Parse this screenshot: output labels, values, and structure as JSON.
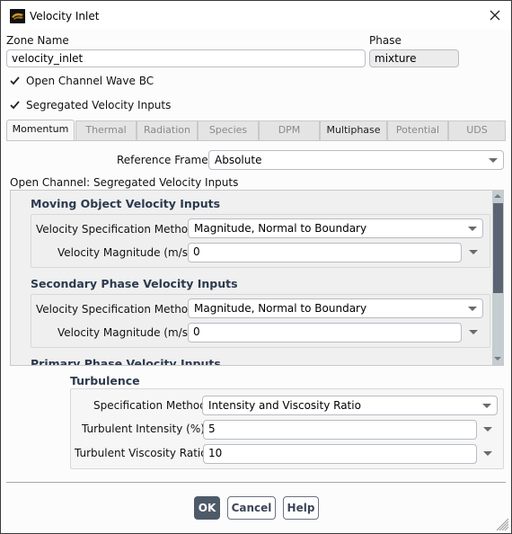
{
  "window": {
    "title": "Velocity Inlet",
    "icon": "ansys-fluent-icon",
    "close_icon": "close-icon"
  },
  "zone": {
    "label": "Zone Name",
    "value": "velocity_inlet"
  },
  "phase": {
    "label": "Phase",
    "value": "mixture"
  },
  "checkboxes": {
    "open_channel": {
      "label": "Open Channel Wave BC",
      "checked": true
    },
    "segregated": {
      "label": "Segregated Velocity Inputs",
      "checked": true
    }
  },
  "tabs": [
    {
      "label": "Momentum",
      "active": true
    },
    {
      "label": "Thermal",
      "active": false
    },
    {
      "label": "Radiation",
      "active": false
    },
    {
      "label": "Species",
      "active": false
    },
    {
      "label": "DPM",
      "active": false
    },
    {
      "label": "Multiphase",
      "active": false
    },
    {
      "label": "Potential",
      "active": false
    },
    {
      "label": "UDS",
      "active": false
    }
  ],
  "momentum": {
    "reference_frame": {
      "label": "Reference Frame",
      "value": "Absolute"
    },
    "open_channel_title": "Open Channel: Segregated Velocity Inputs",
    "moving_object": {
      "title": "Moving Object Velocity Inputs",
      "spec_method_label": "Velocity Specification Method",
      "spec_method_value": "Magnitude, Normal to Boundary",
      "magnitude_label": "Velocity Magnitude (m/s)",
      "magnitude_value": "0"
    },
    "secondary_phase": {
      "title": "Secondary Phase Velocity Inputs",
      "spec_method_label": "Velocity Specification Method",
      "spec_method_value": "Magnitude, Normal to Boundary",
      "magnitude_label": "Velocity Magnitude (m/s)",
      "magnitude_value": "0"
    },
    "primary_phase": {
      "title": "Primary Phase Velocity Inputs"
    },
    "turbulence": {
      "title": "Turbulence",
      "spec_method_label": "Specification Method",
      "spec_method_value": "Intensity and Viscosity Ratio",
      "intensity_label": "Turbulent Intensity (%)",
      "intensity_value": "5",
      "viscosity_label": "Turbulent Viscosity Ratio",
      "viscosity_value": "10"
    }
  },
  "buttons": {
    "ok": "OK",
    "cancel": "Cancel",
    "help": "Help"
  },
  "colors": {
    "primary_button": "#4f5a68",
    "section_title": "#2c3a4f",
    "scroll_thumb": "#5b6472"
  }
}
